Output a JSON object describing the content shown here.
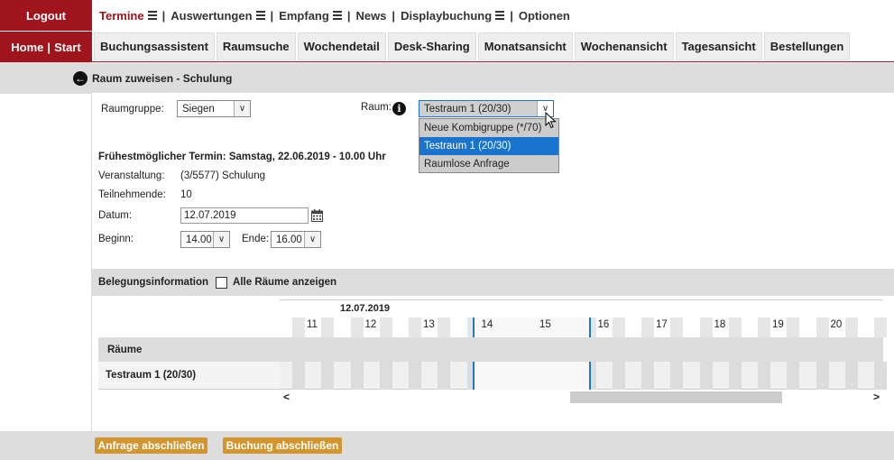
{
  "left": {
    "logout": "Logout",
    "home": "Home",
    "start": "Start"
  },
  "topmenu": [
    {
      "label": "Termine",
      "burger": true,
      "active": true
    },
    {
      "label": "Auswertungen",
      "burger": true
    },
    {
      "label": "Empfang",
      "burger": true
    },
    {
      "label": "News",
      "burger": false
    },
    {
      "label": "Displaybuchung",
      "burger": true
    },
    {
      "label": "Optionen",
      "burger": false
    }
  ],
  "tabs": [
    "Buchungsassistent",
    "Raumsuche",
    "Wochendetail",
    "Desk-Sharing",
    "Monatsansicht",
    "Wochenansicht",
    "Tagesansicht",
    "Bestellungen"
  ],
  "page": {
    "title": "Raum zuweisen - Schulung"
  },
  "form": {
    "raumgruppe_label": "Raumgruppe:",
    "raumgruppe_value": "Siegen",
    "raum_label": "Raum:",
    "raum_value": "Testraum 1 (20/30)",
    "raum_options": [
      "Neue Kombigruppe (*/70)",
      "Testraum 1 (20/30)",
      "Raumlose Anfrage"
    ],
    "earliest": "Frühestmöglicher Termin: Samstag, 22.06.2019 - 10.00 Uhr",
    "veranstaltung_label": "Veranstaltung:",
    "veranstaltung_value": "(3/5577) Schulung",
    "teilnehmende_label": "Teilnehmende:",
    "teilnehmende_value": "10",
    "datum_label": "Datum:",
    "datum_value": "12.07.2019",
    "beginn_label": "Beginn:",
    "beginn_value": "14.00",
    "ende_label": "Ende:",
    "ende_value": "16.00"
  },
  "belegung": {
    "title": "Belegungsinformation",
    "checkbox_label": "Alle Räume anzeigen",
    "date": "12.07.2019",
    "hours": [
      "11",
      "12",
      "13",
      "14",
      "15",
      "16",
      "17",
      "18",
      "19",
      "20"
    ],
    "rooms_header": "Räume",
    "room": "Testraum 1 (20/30)",
    "scroll_left": "<",
    "scroll_right": ">"
  },
  "buttons": {
    "anfrage": "Anfrage abschließen",
    "buchung": "Buchung abschließen"
  },
  "colors": {
    "brand": "#a0141c",
    "accent_orange": "#d3952e",
    "select_blue": "#1874cd",
    "marker_blue": "#1a7bc0"
  }
}
